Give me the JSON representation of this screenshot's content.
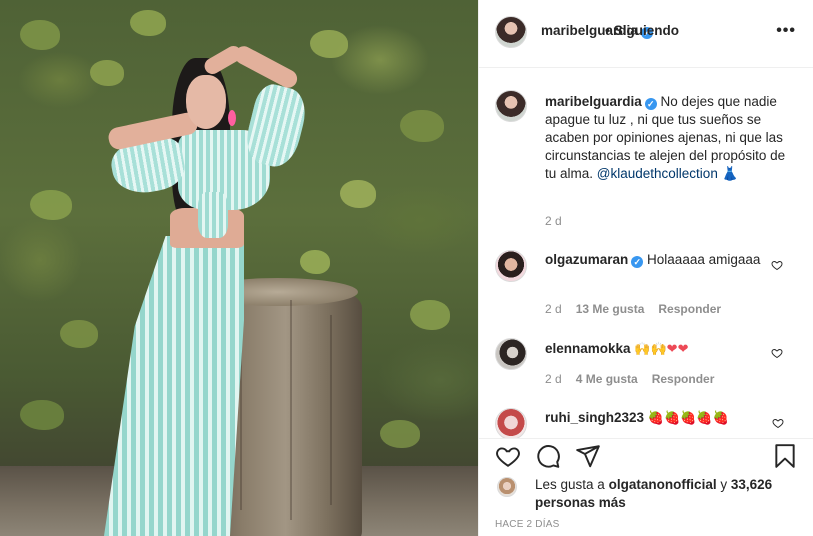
{
  "post": {
    "author": "maribelguardia",
    "verified_mark": "✓",
    "follow_separator": "•",
    "follow_status": "Siguiendo",
    "more_label": "•••"
  },
  "caption": {
    "author": "maribelguardia",
    "text": "No dejes que nadie apague tu luz , ni que tus sueños se acaben por opiniones ajenas, ni que las circunstancias te alejen del propósito de tu alma.",
    "mention": "@klaudethcollection",
    "emoji": "👗",
    "time": "2 d"
  },
  "comments": [
    {
      "author": "olgazumaran",
      "verified": true,
      "text": "Holaaaaa amigaaa",
      "time": "2 d",
      "likes": "13 Me gusta",
      "reply": "Responder"
    },
    {
      "author": "elennamokka",
      "verified": false,
      "text": "🙌🙌❤❤",
      "time": "2 d",
      "likes": "4 Me gusta",
      "reply": "Responder"
    },
    {
      "author": "ruhi_singh2323",
      "verified": false,
      "text": "🍓🍓🍓🍓🍓"
    }
  ],
  "likes": {
    "prefix": "Les gusta a",
    "user": "olgatanonofficial",
    "conj": "y",
    "count_text": "33,626 personas más"
  },
  "timestamp": "HACE 2 DÍAS",
  "icons": {
    "like": "heart-icon",
    "comment": "comment-icon",
    "share": "share-icon",
    "save": "bookmark-icon"
  },
  "colors": {
    "verified": "#3897f0",
    "mention": "#00376b",
    "muted": "#8e8e8e"
  }
}
